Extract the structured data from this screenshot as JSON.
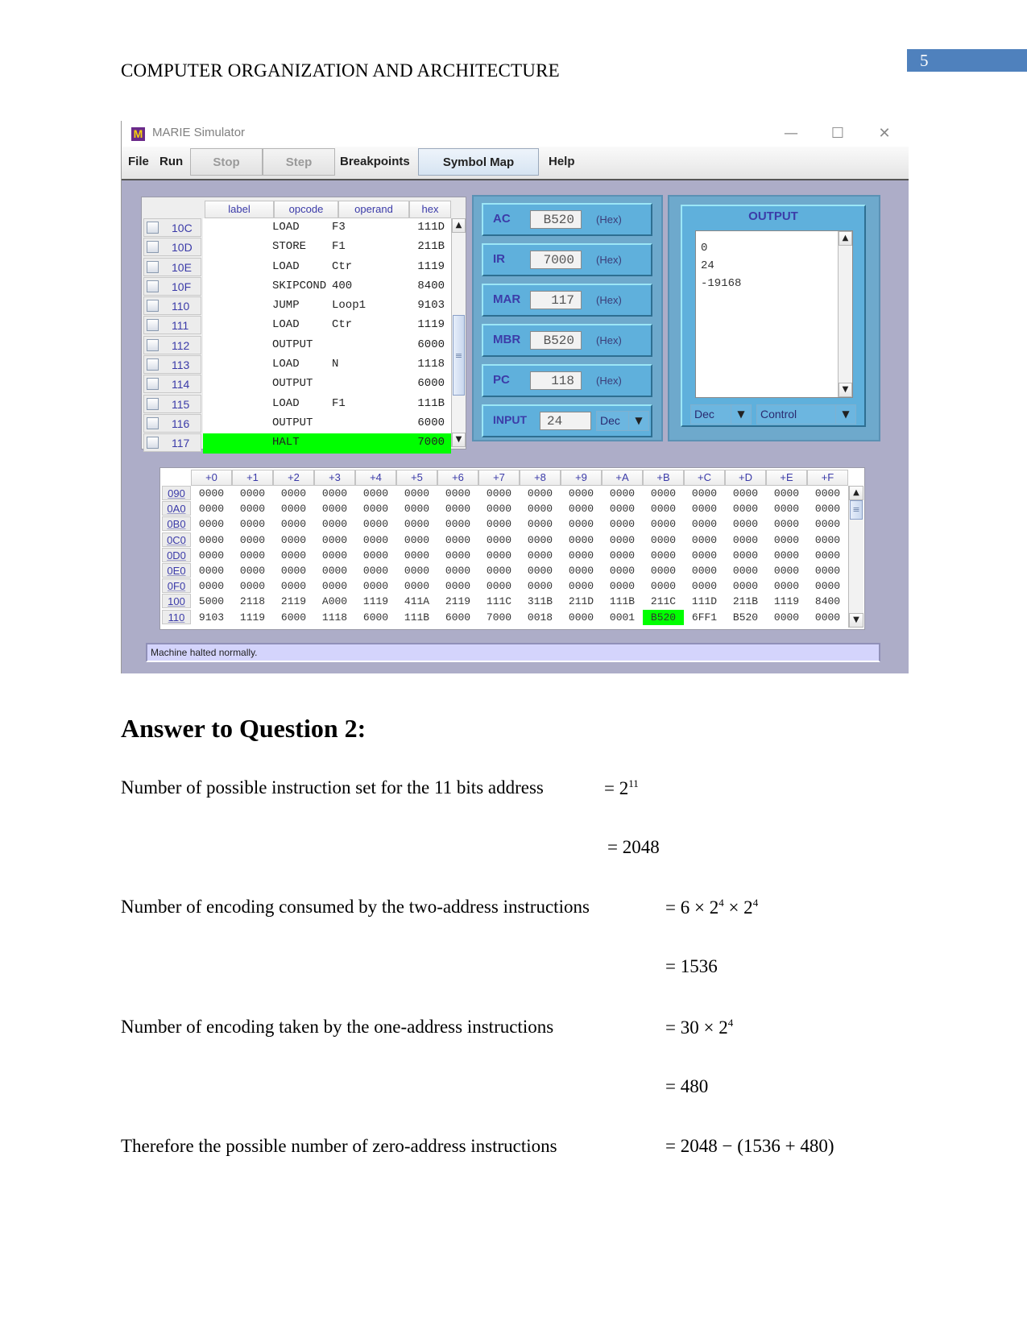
{
  "header": {
    "running_title": "COMPUTER ORGANIZATION AND ARCHITECTURE",
    "page_number": "5"
  },
  "window": {
    "title": "MARIE Simulator",
    "controls": {
      "minimize": "—",
      "maximize": "☐",
      "close": "✕"
    },
    "menu": {
      "file": "File",
      "run": "Run",
      "stop": "Stop",
      "step": "Step",
      "breakpoints": "Breakpoints",
      "symbol_map": "Symbol Map",
      "help": "Help"
    },
    "program": {
      "columns": [
        "label",
        "opcode",
        "operand",
        "hex"
      ],
      "rows": [
        {
          "addr": "10C",
          "label": "",
          "opcode": "LOAD",
          "operand": "F3",
          "hex": "111D"
        },
        {
          "addr": "10D",
          "label": "",
          "opcode": "STORE",
          "operand": "F1",
          "hex": "211B"
        },
        {
          "addr": "10E",
          "label": "",
          "opcode": "LOAD",
          "operand": "Ctr",
          "hex": "1119"
        },
        {
          "addr": "10F",
          "label": "",
          "opcode": "SKIPCOND",
          "operand": "400",
          "hex": "8400"
        },
        {
          "addr": "110",
          "label": "",
          "opcode": "JUMP",
          "operand": "Loop1",
          "hex": "9103"
        },
        {
          "addr": "111",
          "label": "",
          "opcode": "LOAD",
          "operand": "Ctr",
          "hex": "1119"
        },
        {
          "addr": "112",
          "label": "",
          "opcode": "OUTPUT",
          "operand": "",
          "hex": "6000"
        },
        {
          "addr": "113",
          "label": "",
          "opcode": "LOAD",
          "operand": "N",
          "hex": "1118"
        },
        {
          "addr": "114",
          "label": "",
          "opcode": "OUTPUT",
          "operand": "",
          "hex": "6000"
        },
        {
          "addr": "115",
          "label": "",
          "opcode": "LOAD",
          "operand": "F1",
          "hex": "111B"
        },
        {
          "addr": "116",
          "label": "",
          "opcode": "OUTPUT",
          "operand": "",
          "hex": "6000"
        },
        {
          "addr": "117",
          "label": "",
          "opcode": "HALT",
          "operand": "",
          "hex": "7000",
          "highlight": true
        }
      ]
    },
    "registers": [
      {
        "name": "AC",
        "value": "B520",
        "format": "(Hex)"
      },
      {
        "name": "IR",
        "value": "7000",
        "format": "(Hex)"
      },
      {
        "name": "MAR",
        "value": "117",
        "format": "(Hex)"
      },
      {
        "name": "MBR",
        "value": "B520",
        "format": "(Hex)"
      },
      {
        "name": "PC",
        "value": "118",
        "format": "(Hex)"
      }
    ],
    "input": {
      "label": "INPUT",
      "value": "24",
      "mode": "Dec"
    },
    "output": {
      "title": "OUTPUT",
      "lines": [
        "0",
        "24",
        "-19168"
      ],
      "mode": "Dec",
      "control": "Control"
    },
    "memory": {
      "columns": [
        "+0",
        "+1",
        "+2",
        "+3",
        "+4",
        "+5",
        "+6",
        "+7",
        "+8",
        "+9",
        "+A",
        "+B",
        "+C",
        "+D",
        "+E",
        "+F"
      ],
      "rows": [
        {
          "addr": "090",
          "cells": [
            "0000",
            "0000",
            "0000",
            "0000",
            "0000",
            "0000",
            "0000",
            "0000",
            "0000",
            "0000",
            "0000",
            "0000",
            "0000",
            "0000",
            "0000",
            "0000"
          ]
        },
        {
          "addr": "0A0",
          "cells": [
            "0000",
            "0000",
            "0000",
            "0000",
            "0000",
            "0000",
            "0000",
            "0000",
            "0000",
            "0000",
            "0000",
            "0000",
            "0000",
            "0000",
            "0000",
            "0000"
          ]
        },
        {
          "addr": "0B0",
          "cells": [
            "0000",
            "0000",
            "0000",
            "0000",
            "0000",
            "0000",
            "0000",
            "0000",
            "0000",
            "0000",
            "0000",
            "0000",
            "0000",
            "0000",
            "0000",
            "0000"
          ]
        },
        {
          "addr": "0C0",
          "cells": [
            "0000",
            "0000",
            "0000",
            "0000",
            "0000",
            "0000",
            "0000",
            "0000",
            "0000",
            "0000",
            "0000",
            "0000",
            "0000",
            "0000",
            "0000",
            "0000"
          ]
        },
        {
          "addr": "0D0",
          "cells": [
            "0000",
            "0000",
            "0000",
            "0000",
            "0000",
            "0000",
            "0000",
            "0000",
            "0000",
            "0000",
            "0000",
            "0000",
            "0000",
            "0000",
            "0000",
            "0000"
          ]
        },
        {
          "addr": "0E0",
          "cells": [
            "0000",
            "0000",
            "0000",
            "0000",
            "0000",
            "0000",
            "0000",
            "0000",
            "0000",
            "0000",
            "0000",
            "0000",
            "0000",
            "0000",
            "0000",
            "0000"
          ]
        },
        {
          "addr": "0F0",
          "cells": [
            "0000",
            "0000",
            "0000",
            "0000",
            "0000",
            "0000",
            "0000",
            "0000",
            "0000",
            "0000",
            "0000",
            "0000",
            "0000",
            "0000",
            "0000",
            "0000"
          ]
        },
        {
          "addr": "100",
          "cells": [
            "5000",
            "2118",
            "2119",
            "A000",
            "1119",
            "411A",
            "2119",
            "111C",
            "311B",
            "211D",
            "111B",
            "211C",
            "111D",
            "211B",
            "1119",
            "8400"
          ]
        },
        {
          "addr": "110",
          "cells": [
            "9103",
            "1119",
            "6000",
            "1118",
            "6000",
            "111B",
            "6000",
            "7000",
            "0018",
            "0000",
            "0001",
            "B520",
            "6FF1",
            "B520",
            "0000",
            "0000"
          ],
          "highlight_index": 11
        }
      ]
    },
    "status": "Machine halted normally."
  },
  "answer": {
    "heading": "Answer to Question 2:",
    "lines": [
      {
        "label": "Number of possible instruction set for the 11 bits address",
        "expr": [
          "= 2",
          "11",
          ""
        ]
      },
      {
        "label": "",
        "expr": [
          "= 2048"
        ]
      },
      {
        "label": "Number of encoding consumed by the two-address instructions",
        "expr": [
          "= 6 × 2",
          "4",
          " × 2",
          "4"
        ]
      },
      {
        "label": "",
        "expr": [
          "= 1536"
        ]
      },
      {
        "label": "Number of encoding taken by the one-address instructions",
        "expr": [
          "= 30 × 2",
          "4"
        ]
      },
      {
        "label": "",
        "expr": [
          "= 480"
        ]
      },
      {
        "label": "Therefore the possible number of zero-address instructions",
        "expr": [
          "= 2048 − (1536 + 480)"
        ]
      }
    ]
  }
}
